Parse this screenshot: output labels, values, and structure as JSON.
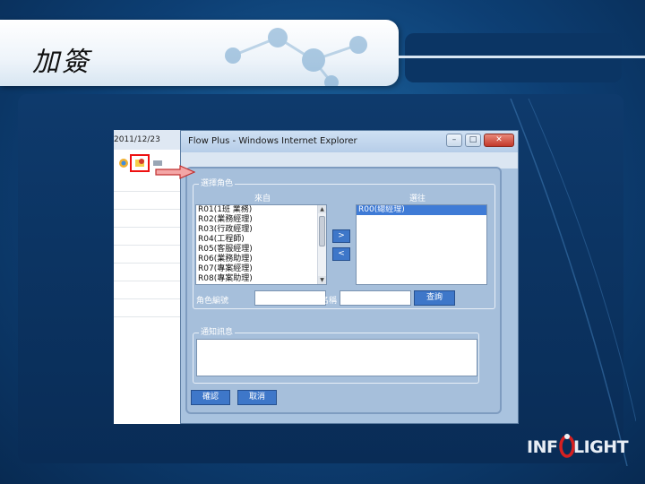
{
  "slide": {
    "title": "加簽"
  },
  "bg_app": {
    "date": "2011/12/23"
  },
  "ie": {
    "title": "Flow Plus - Windows Internet Explorer",
    "btn_minimize": "–",
    "btn_maximize": "□",
    "btn_close": "✕"
  },
  "dialog": {
    "role_select": {
      "legend": "選擇角色",
      "candidates_label": "來自",
      "selected_label": "選往",
      "candidates": [
        "R01(1班 業務)",
        "R02(業務經理)",
        "R03(行政經理)",
        "R04(工程師)",
        "R05(客服經理)",
        "R06(業務助理)",
        "R07(專案經理)",
        "R08(專案助理)"
      ],
      "selected": [
        "R00(總經理)"
      ],
      "add_button": ">",
      "remove_button": "<"
    },
    "search": {
      "role_code_label": "角色編號",
      "role_code_value": "",
      "role_name_label": "角色名稱",
      "role_name_value": "",
      "query_button": "查詢"
    },
    "notify": {
      "legend": "通知訊息",
      "message": ""
    },
    "confirm_button": "確認",
    "cancel_button": "取消"
  },
  "logo": {
    "text_left": "INF",
    "text_right": "LIGHT",
    "brand_color": "#d62020"
  },
  "colors": {
    "dialog_bg": "#a6bfdb",
    "button_blue": "#3e77c9",
    "highlight_red": "#e11111"
  }
}
